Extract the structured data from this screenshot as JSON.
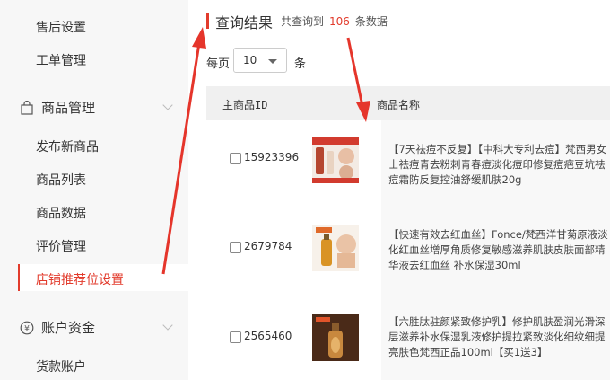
{
  "sidebar": {
    "items_top": [
      "售后设置",
      "工单管理"
    ],
    "group_goods": {
      "label": "商品管理",
      "icon": "bag-icon"
    },
    "goods_items": [
      "发布新商品",
      "商品列表",
      "商品数据",
      "评价管理",
      "店铺推荐位设置"
    ],
    "active_item": "店铺推荐位设置",
    "group_account": {
      "label": "账户资金",
      "icon": "yen-icon"
    },
    "account_items": [
      "货款账户"
    ]
  },
  "main": {
    "title": "查询结果",
    "summary_prefix": "共查询到",
    "summary_count": "106",
    "summary_suffix": "条数据",
    "perpage_label": "每页",
    "perpage_value": "10",
    "perpage_unit": "条",
    "columns": [
      "主商品ID",
      "商品名称"
    ],
    "rows": [
      {
        "id": "15923396",
        "name": "【7天祛痘不反复】【中科大专利去痘】梵西男女士祛痘青去粉刺青春痘淡化痘印修复痘疤豆坑祛痘霜防反复控油舒缓肌肤20g"
      },
      {
        "id": "2679784",
        "name": "【快速有效去红血丝】Fonce/梵西洋甘菊原液淡化红血丝增厚角质修复敏感滋养肌肤皮肤面部精华液去红血丝 补水保湿30ml"
      },
      {
        "id": "2565460",
        "name": "【六胜肽驻颜紧致修护乳】修护肌肤盈润光滑深层滋养补水保湿乳液修护提拉紧致淡化细纹细提亮肤色梵西正品100ml【买1送3】"
      }
    ]
  },
  "colors": {
    "accent": "#e23b2c",
    "sidebar_bg": "#f7f7f7",
    "header_bg": "#f0f0f0"
  }
}
